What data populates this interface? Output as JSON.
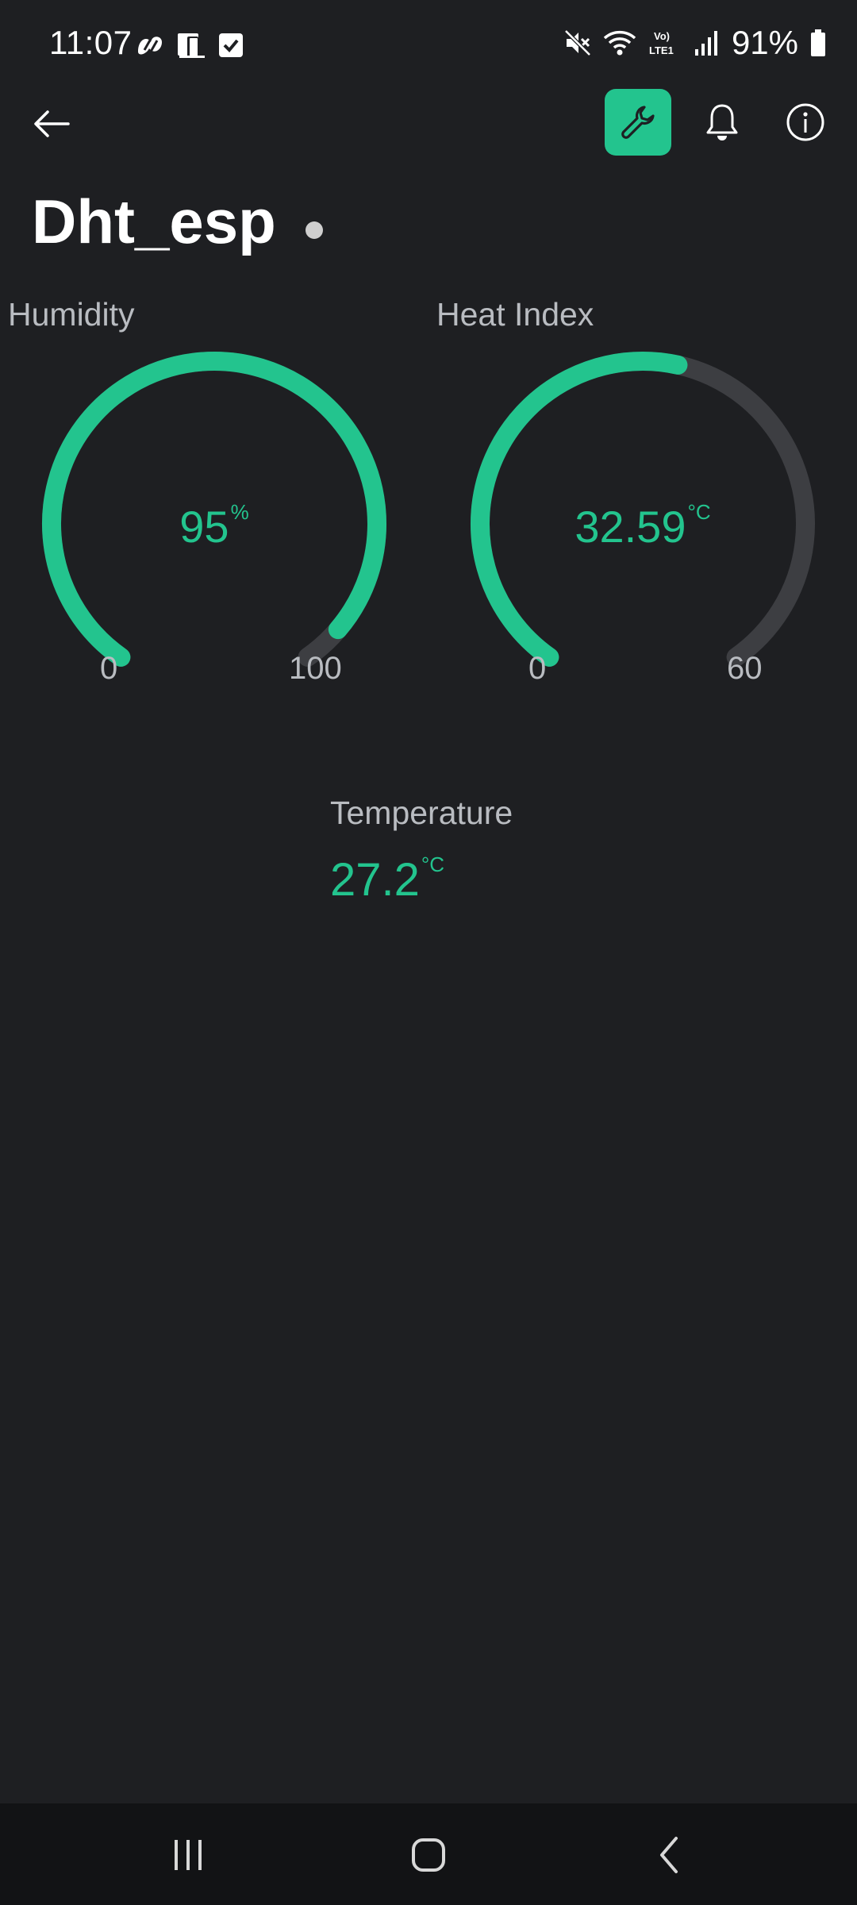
{
  "status_bar": {
    "time": "11:07",
    "battery_text": "91%",
    "left_icons": [
      "app-notification-icon",
      "device-notification-icon",
      "checkbox-notification-icon"
    ],
    "right_icons": [
      "mute-icon",
      "wifi-icon",
      "volte-lte-icon",
      "signal-icon",
      "battery-icon"
    ]
  },
  "app_bar": {
    "back_icon": "back-arrow-icon",
    "edit_icon": "wrench-icon",
    "notifications_icon": "bell-icon",
    "info_icon": "info-icon"
  },
  "device": {
    "title": "Dht_esp"
  },
  "gauges": [
    {
      "label": "Humidity",
      "value": "95",
      "unit": "%",
      "min": "0",
      "max": "100",
      "numeric_value": 95,
      "numeric_min": 0,
      "numeric_max": 100
    },
    {
      "label": "Heat Index",
      "value": "32.59",
      "unit": "°C",
      "min": "0",
      "max": "60",
      "numeric_value": 32.59,
      "numeric_min": 0,
      "numeric_max": 60
    }
  ],
  "temperature": {
    "label": "Temperature",
    "value": "27.2",
    "unit": "°C"
  },
  "nav_bar": {
    "recents_icon": "recents-icon",
    "home_icon": "home-icon",
    "back_icon": "nav-back-icon"
  },
  "colors": {
    "accent": "#23c48e",
    "background": "#1e1f22",
    "track": "#3d3e42",
    "label": "#b9bcc1",
    "nav_background": "#121315"
  }
}
